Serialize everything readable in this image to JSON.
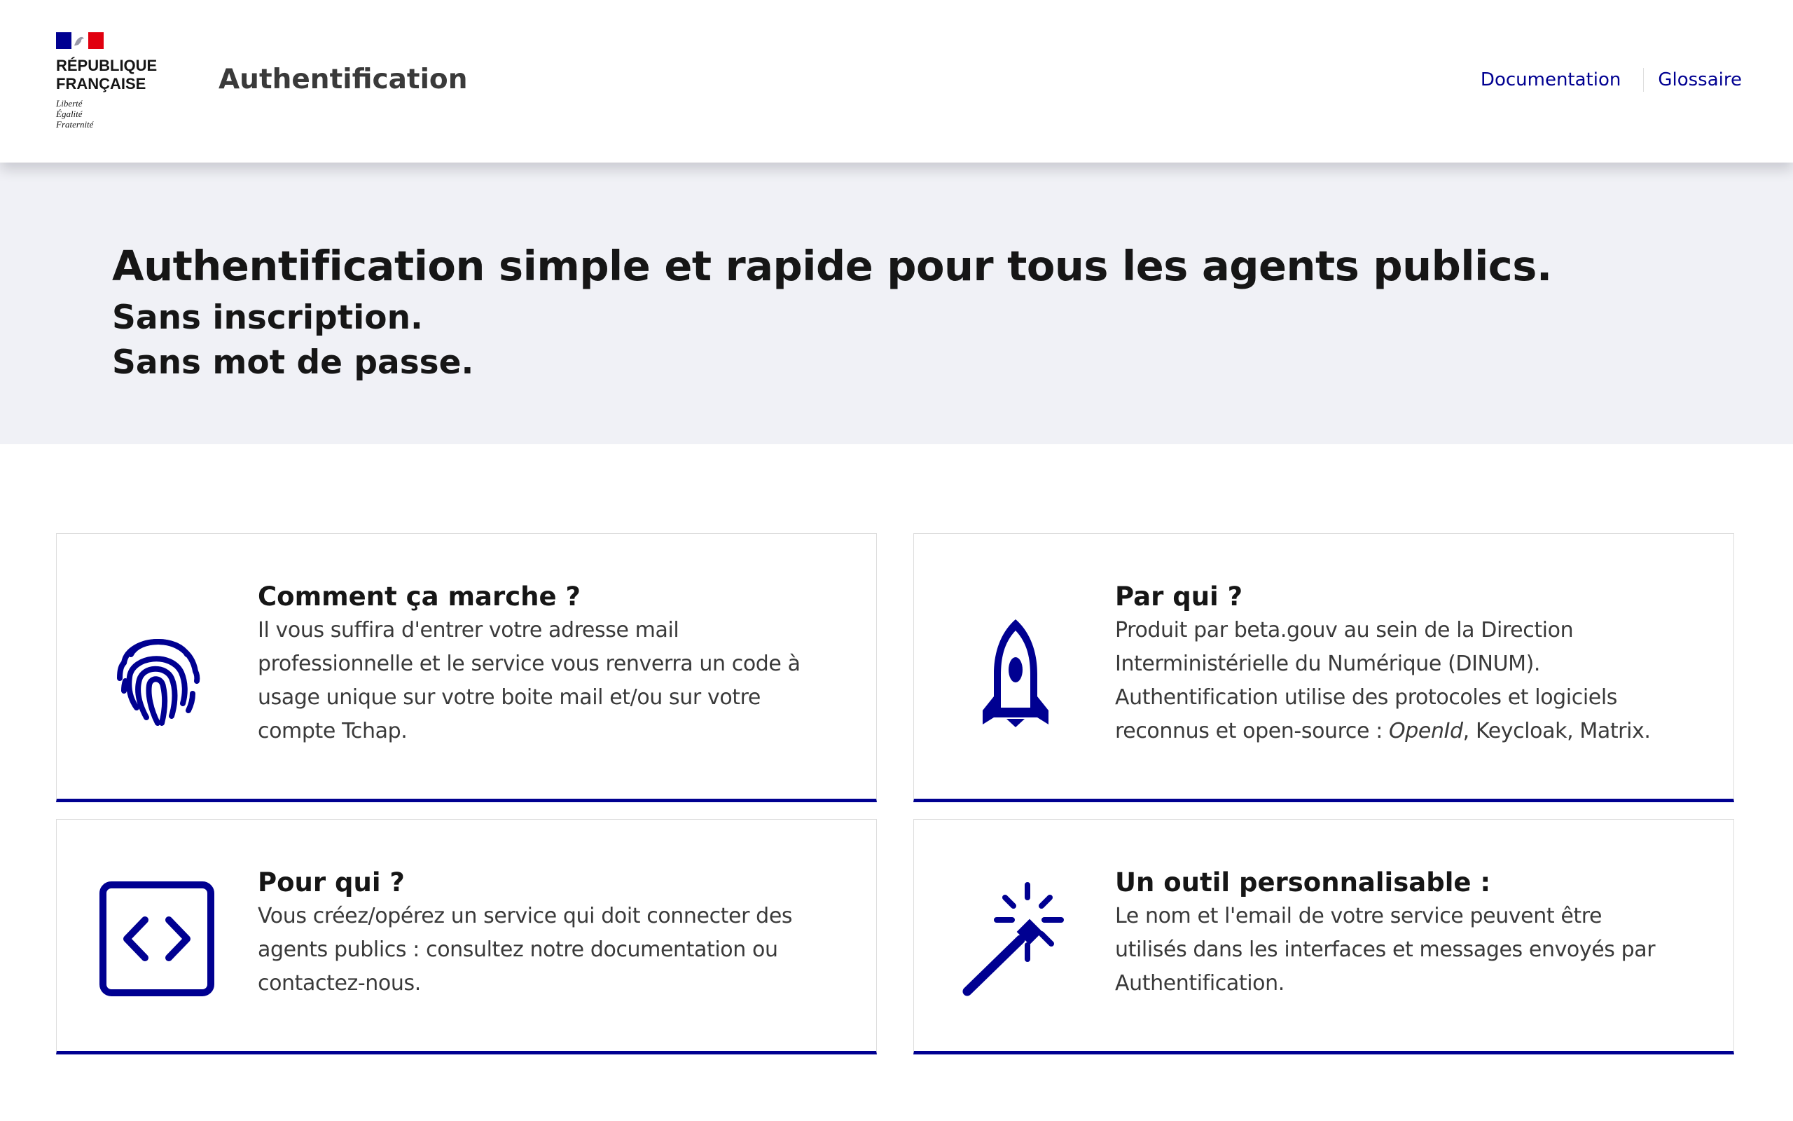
{
  "header": {
    "logo": {
      "name_line1": "RÉPUBLIQUE",
      "name_line2": "FRANÇAISE",
      "motto_line1": "Liberté",
      "motto_line2": "Égalité",
      "motto_line3": "Fraternité"
    },
    "service_title": "Authentification",
    "nav": [
      {
        "label": "Documentation"
      },
      {
        "label": "Glossaire"
      }
    ]
  },
  "hero": {
    "title": "Authentification simple et rapide pour tous les agents publics.",
    "subtitle_line1": "Sans inscription.",
    "subtitle_line2": "Sans mot de passe."
  },
  "cards": [
    {
      "title": "Comment ça marche ?",
      "icon": "fingerprint-icon",
      "lines": [
        "Il vous suffira d'entrer votre adresse mail",
        "professionnelle et le service vous renverra un code à",
        "usage unique sur votre boite mail et/ou sur votre",
        "compte Tchap."
      ]
    },
    {
      "title": "Par qui ?",
      "icon": "rocket-icon",
      "lines": [
        "Produit par beta.gouv au sein de la Direction",
        "Interministérielle du Numérique (DINUM).",
        "Authentification utilise des protocoles et logiciels"
      ],
      "line4_prefix": "reconnus et open-source : ",
      "line4_italic": "OpenId",
      "line4_suffix": ", Keycloak, Matrix."
    },
    {
      "title": "Pour qui ?",
      "icon": "code-icon",
      "lines": [
        "Vous créez/opérez un service qui doit connecter des",
        "agents publics : consultez notre documentation ou",
        "contactez-nous."
      ]
    },
    {
      "title": "Un outil personnalisable :",
      "icon": "magic-wand-icon",
      "lines": [
        "Le nom et l'email de votre service peuvent être",
        "utilisés dans les interfaces et messages envoyés par",
        "Authentification."
      ]
    }
  ],
  "colors": {
    "accent": "#000091",
    "hero_background": "#f0f1f6",
    "flag_red": "#e1000f"
  }
}
